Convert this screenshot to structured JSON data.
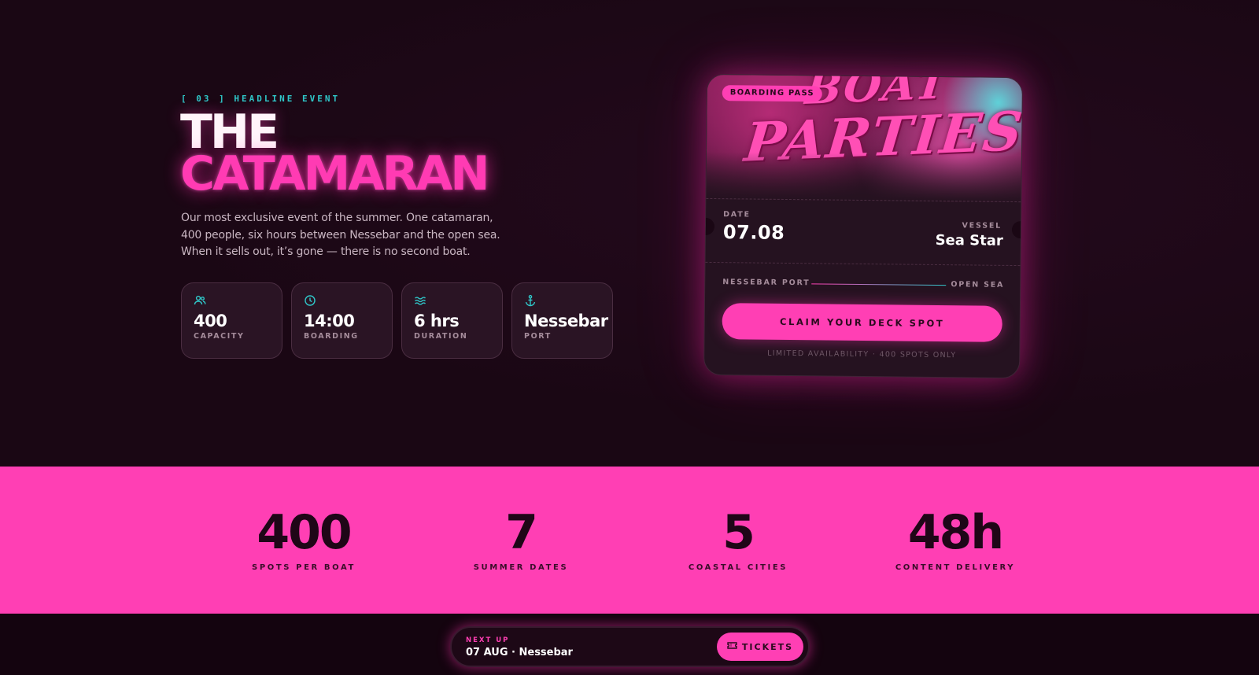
{
  "hero": {
    "eyebrow": "[ 03 ] HEADLINE EVENT",
    "title_line1": "THE",
    "title_line2": "CATAMARAN",
    "description": "Our most exclusive event of the summer. One catamaran, 400 people, six hours between Nessebar and the open sea. When it sells out, it’s gone — there is no second boat.",
    "stats": [
      {
        "icon": "users-icon",
        "value": "400",
        "label": "CAPACITY"
      },
      {
        "icon": "clock-icon",
        "value": "14:00",
        "label": "BOARDING"
      },
      {
        "icon": "waves-icon",
        "value": "6 hrs",
        "label": "DURATION"
      },
      {
        "icon": "anchor-icon",
        "value": "Nessebar",
        "label": "PORT"
      }
    ]
  },
  "ticket": {
    "badge": "BOARDING PASS",
    "art_line1": "BOAT",
    "art_line2": "PARTIES",
    "date_label": "DATE",
    "date": "07.08",
    "vessel_label": "VESSEL",
    "vessel": "Sea Star",
    "route_from": "NESSEBAR PORT",
    "route_to": "OPEN SEA",
    "cta": "CLAIM YOUR DECK SPOT",
    "note": "LIMITED AVAILABILITY · 400 SPOTS ONLY"
  },
  "band": {
    "items": [
      {
        "value": "400",
        "label": "SPOTS PER BOAT"
      },
      {
        "value": "7",
        "label": "SUMMER DATES"
      },
      {
        "value": "5",
        "label": "COASTAL CITIES"
      },
      {
        "value": "48h",
        "label": "CONTENT DELIVERY"
      }
    ]
  },
  "next_up": {
    "label": "NEXT UP",
    "value": "07 AUG · Nessebar",
    "button": "TICKETS"
  },
  "colors": {
    "background": "#1a0714",
    "accent_pink": "#ff3fb4",
    "accent_teal": "#2fc7c9"
  }
}
